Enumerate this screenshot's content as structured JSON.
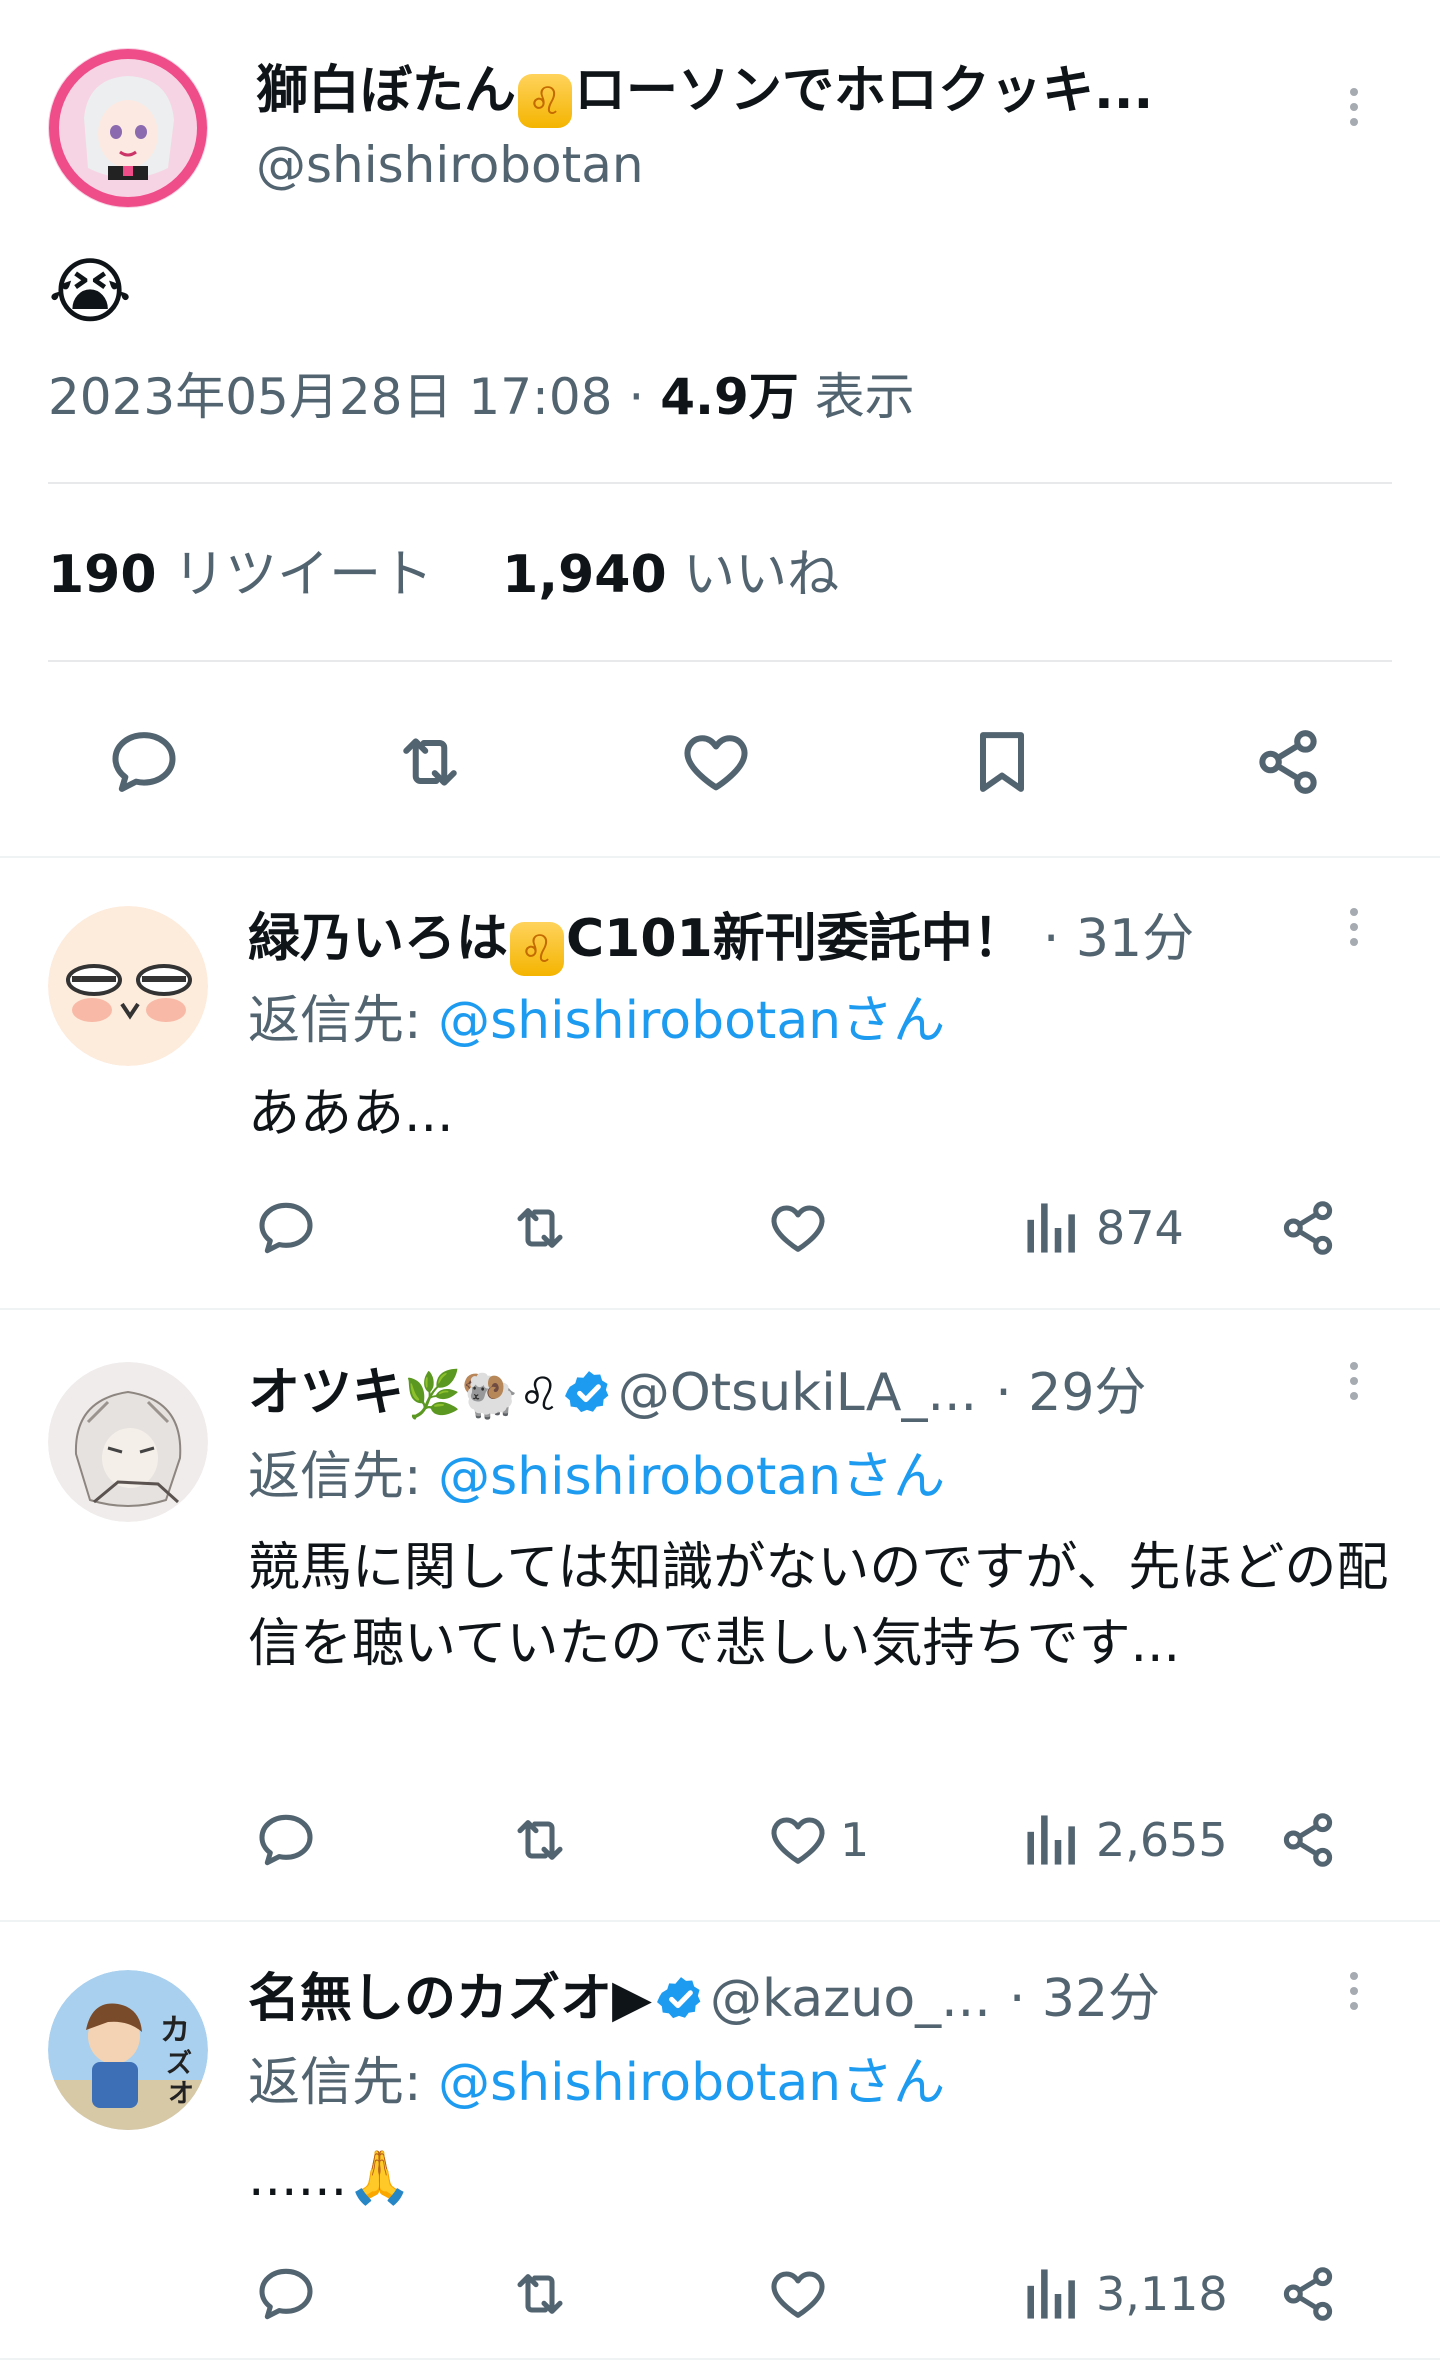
{
  "main_tweet": {
    "display_name": "獅白ぼたん",
    "name_badge": "♌",
    "name_suffix": "ローソンでホロクッキ...",
    "handle": "@shishirobotan",
    "body": "😭",
    "timestamp": "2023年05月28日 17:08",
    "separator": "·",
    "views_count": "4.9万",
    "views_label": "表示",
    "retweets_count": "190",
    "retweets_label": "リツイート",
    "likes_count": "1,940",
    "likes_label": "いいね",
    "avatar_color": "#f8d7e6"
  },
  "replies": [
    {
      "display_name": "緑乃いろは",
      "name_badge": "♌",
      "name_suffix": "C101新刊委託中！",
      "handle": "",
      "time": "· 31分",
      "reply_to_label": "返信先: ",
      "reply_to_handle": "@shishirobotan",
      "reply_to_suffix": "さん",
      "body": "あああ...",
      "reply_count": "",
      "retweet_count": "",
      "like_count": "",
      "view_count": "874",
      "verified": false,
      "avatar_color": "#fde8d8"
    },
    {
      "display_name": "オツキ",
      "name_badge": "🌿🐏♌",
      "name_suffix": "",
      "handle": "@OtsukiLA_...",
      "time": "· 29分",
      "reply_to_label": "返信先: ",
      "reply_to_handle": "@shishirobotan",
      "reply_to_suffix": "さん",
      "body": "競馬に関しては知識がないのですが、先ほどの配信を聴いていたので悲しい気持ちです...",
      "reply_count": "",
      "retweet_count": "",
      "like_count": "1",
      "view_count": "2,655",
      "verified": true,
      "avatar_color": "#ece8e6"
    },
    {
      "display_name": "名無しのカズオ▶",
      "name_badge": "",
      "name_suffix": "",
      "handle": "@kazuo_...",
      "time": "· 32分",
      "reply_to_label": "返信先: ",
      "reply_to_handle": "@shishirobotan",
      "reply_to_suffix": "さん",
      "body": "......🙏",
      "reply_count": "",
      "retweet_count": "",
      "like_count": "",
      "view_count": "3,118",
      "verified": true,
      "avatar_color": "#9ec7ea"
    }
  ],
  "colors": {
    "accent": "#1d9bf0",
    "text": "#0f1419",
    "muted": "#536471",
    "divider": "#eff3f4"
  },
  "icons": {
    "reply": "reply-icon",
    "retweet": "retweet-icon",
    "like": "heart-icon",
    "bookmark": "bookmark-icon",
    "share": "share-icon",
    "views": "views-icon",
    "more": "more-vertical-icon",
    "verified": "verified-badge-icon"
  }
}
